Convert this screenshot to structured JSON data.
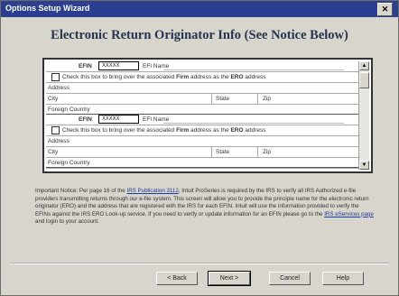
{
  "window": {
    "title": "Options Setup Wizard",
    "close_label": "✕"
  },
  "heading": "Electronic Return Originator Info (See Notice Below)",
  "entries": [
    {
      "efin_label": "EFIN",
      "efin_value": "XXXXX",
      "efin_name_label": "EFI Name",
      "check_prefix": "Check this box to bring over the associated ",
      "check_firm": "Firm",
      "check_middle": " address as the ",
      "check_ero": "ERO",
      "check_suffix": " address",
      "address_label": "Address",
      "city_label": "City",
      "state_label": "State",
      "zip_label": "Zip",
      "country_label": "Foreign Country"
    },
    {
      "efin_label": "EFIN",
      "efin_value": "XXXXX",
      "efin_name_label": "EFI Name",
      "check_prefix": "Check this box to bring over the associated ",
      "check_firm": "Firm",
      "check_middle": " address as the ",
      "check_ero": "ERO",
      "check_suffix": " address",
      "address_label": "Address",
      "city_label": "City",
      "state_label": "State",
      "zip_label": "Zip",
      "country_label": "Foreign Country"
    }
  ],
  "notice": {
    "part1": "Important Notice: Per page 16 of the ",
    "link1": "IRS Publication 3112",
    "part2": ", Intuit ProSeries is required by the IRS to verify all IRS Authorized e-file providers transmitting returns through our e-file system.  This screen will allow you to provide the principle name for the electronic return originator (ERO) and the address that are registered with the IRS for each EFIN.  Intuit will use the information provided to verify the EFINs against the IRS ERO Look-up service.  If you need to verify or update information for an EFIN please go to the ",
    "link2": "IRS eServices page",
    "part3": " and login to your account."
  },
  "buttons": {
    "back": "< Back",
    "next": "Next >",
    "cancel": "Cancel",
    "help": "Help"
  }
}
